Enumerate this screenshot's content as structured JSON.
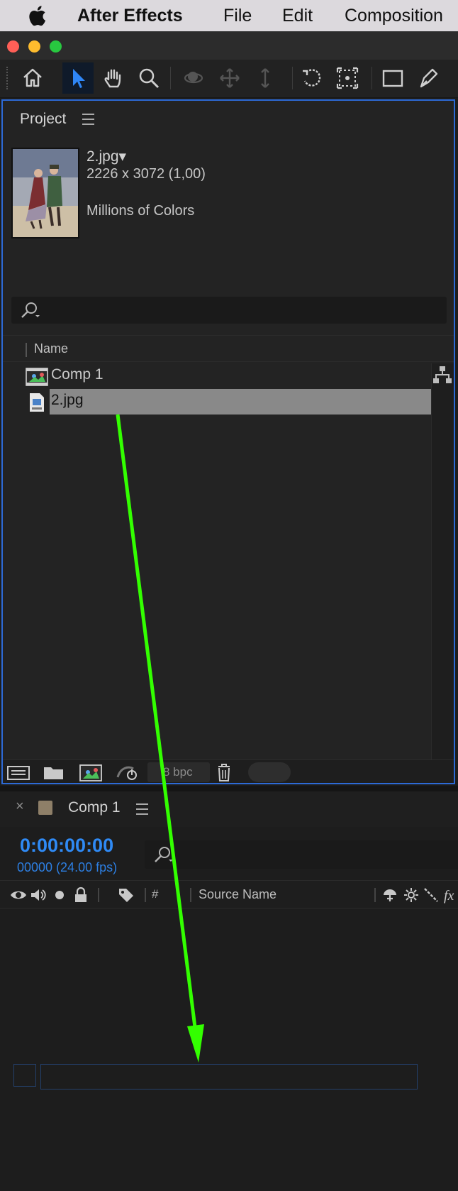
{
  "menubar": {
    "app_name": "After Effects",
    "items": [
      {
        "label": "File"
      },
      {
        "label": "Edit"
      },
      {
        "label": "Composition"
      }
    ]
  },
  "toolbar": {
    "tools": [
      "home-icon",
      "selection-tool-icon",
      "hand-tool-icon",
      "zoom-tool-icon",
      "orbit-camera-icon",
      "pan-camera-icon",
      "dolly-camera-icon",
      "rotation-tool-icon",
      "anchor-point-tool-icon",
      "rectangle-tool-icon",
      "pen-tool-icon"
    ],
    "active_tool": "selection-tool-icon",
    "accent_color": "#2f86f6"
  },
  "project_panel": {
    "title": "Project",
    "preview": {
      "name": "2.jpg▾",
      "dimensions": "2226 x 3072 (1,00)",
      "colors": "Millions of Colors"
    },
    "search": {
      "placeholder": ""
    },
    "column_header": "Name",
    "items": [
      {
        "label": "Comp 1",
        "icon": "composition-icon",
        "selected": false
      },
      {
        "label": "2.jpg",
        "icon": "jpg-file-icon",
        "selected": true
      }
    ],
    "footer": {
      "bit_depth": "8 bpc"
    },
    "border_color": "#2d6ad6"
  },
  "timeline_panel": {
    "tab_title": "Comp 1",
    "close_label": "×",
    "timecode": "0:00:00:00",
    "frame_info": "00000 (24.00 fps)",
    "columns": {
      "hash": "#",
      "source_name": "Source Name"
    },
    "timecode_color": "#2f8af5"
  },
  "annotation": {
    "type": "drag-arrow",
    "color": "#33ff00",
    "from": "project item 2.jpg",
    "to": "timeline layer area"
  }
}
